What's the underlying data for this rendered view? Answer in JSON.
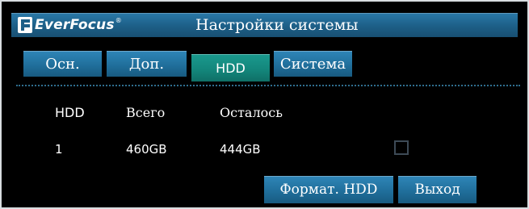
{
  "window": {
    "brand": "EverFocus",
    "brand_mark": "®",
    "title": "Настройки системы"
  },
  "tabs": [
    {
      "label": "Осн.",
      "active": false
    },
    {
      "label": "Доп.",
      "active": false
    },
    {
      "label": "HDD",
      "active": true
    },
    {
      "label": "Система",
      "active": false
    }
  ],
  "table": {
    "headers": [
      "HDD",
      "Всего",
      "Осталось"
    ],
    "rows": [
      {
        "hdd": "1",
        "total": "460GB",
        "remaining": "444GB",
        "checked": false
      }
    ]
  },
  "buttons": {
    "format_label": "Формат. HDD",
    "exit_label": "Выход"
  },
  "colors": {
    "tab_blue": "#1f6d99",
    "tab_active_teal": "#13857a",
    "background": "#000000",
    "text": "#ffffff"
  },
  "icons": {
    "logo": "everfocus-logo-icon"
  }
}
